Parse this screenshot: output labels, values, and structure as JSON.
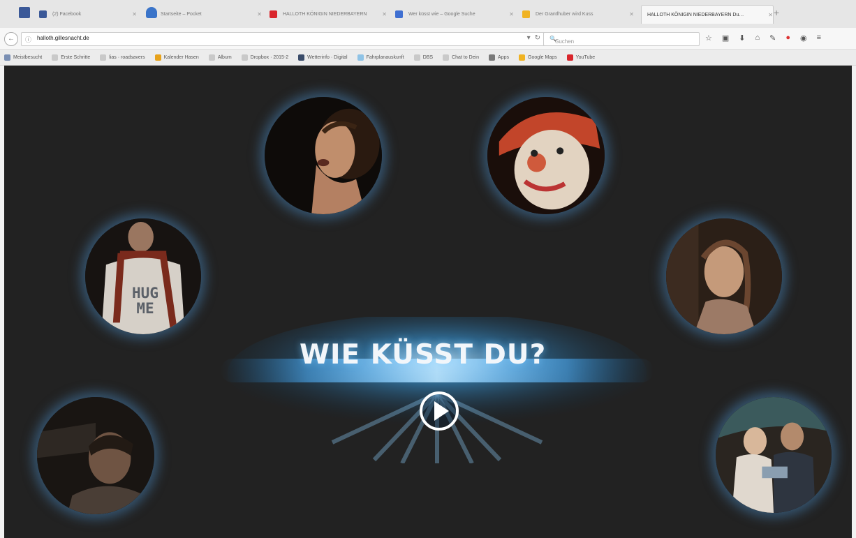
{
  "browser": {
    "pinned_tabs": [
      "facebook-icon",
      "pocket-icon"
    ],
    "tabs": [
      {
        "label": "(2) Facebook",
        "favicon_color": "#3b5998",
        "active": false
      },
      {
        "label": "Startseite – Pocket",
        "favicon_color": "#3a74c9",
        "active": false
      },
      {
        "label": "HALLOTH KÖNIGIN NIEDERBAYERN",
        "favicon_color": "#d9262c",
        "active": false
      },
      {
        "label": "Wer küsst wie – Google Suche",
        "favicon_color": "#3f6fd1",
        "active": false
      },
      {
        "label": "Der Grantlhuber wird Kuss",
        "favicon_color": "#f0b323",
        "active": false
      },
      {
        "label": "HALLOTH KÖNIGIN NIEDERBAYERN Du…",
        "favicon_color": "#2a2a2a",
        "active": true
      }
    ],
    "url": "halloth.gillesnacht.de",
    "search_placeholder": "Suchen",
    "bookmarks": [
      {
        "label": "Meistbesucht",
        "color": "#7a8fb3"
      },
      {
        "label": "Erste Schritte",
        "color": "#c9c9c9"
      },
      {
        "label": "lias · roadsavers",
        "color": "#c9c9c9"
      },
      {
        "label": "Kalender Hasen",
        "color": "#e7a21b"
      },
      {
        "label": "Album",
        "color": "#c9c9c9"
      },
      {
        "label": "Dropbox · 2015-2",
        "color": "#c9c9c9"
      },
      {
        "label": "Wetterinfo · Digital",
        "color": "#3a4c6a"
      },
      {
        "label": "Fahrplanauskunft",
        "color": "#8fc3e6"
      },
      {
        "label": "DBS",
        "color": "#c9c9c9"
      },
      {
        "label": "Chat to Dein",
        "color": "#c9c9c9"
      },
      {
        "label": "Apps",
        "color": "#7a7a7a"
      },
      {
        "label": "Google Maps",
        "color": "#f0b323"
      },
      {
        "label": "YouTube",
        "color": "#d9262c"
      }
    ]
  },
  "page": {
    "headline": "WIE KÜSST DU?",
    "shirt_text_line1": "HUG",
    "shirt_text_line2": "ME",
    "accent_color": "#4fb3ff",
    "background_color": "#222222"
  }
}
